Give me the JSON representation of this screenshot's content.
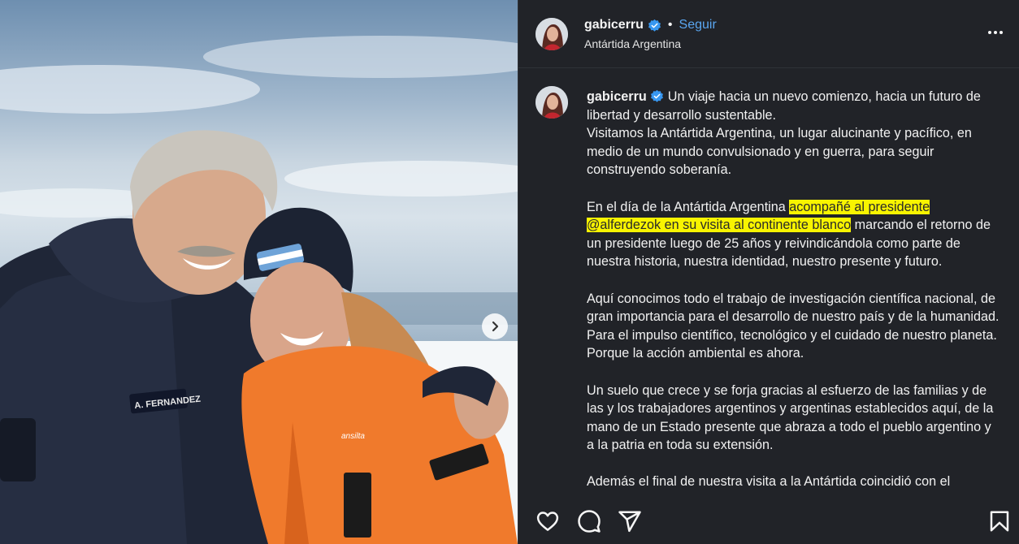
{
  "post": {
    "username": "gabicerru",
    "follow_label": "Seguir",
    "separator": "•",
    "location": "Antártida Argentina"
  },
  "photo": {
    "jacket_badge": "A. FERNANDEZ",
    "jacket_brand": "ansilta"
  },
  "caption": {
    "username": "gabicerru",
    "p1": "Un viaje hacia un nuevo comienzo, hacia un futuro de libertad y desarrollo sustentable.",
    "p1b": "Visitamos la Antártida Argentina, un lugar alucinante y pacífico, en medio de un mundo convulsionado y en guerra, para seguir construyendo soberanía.",
    "p2_before": "En el día de la Antártida Argentina ",
    "p2_highlight": "acompañé al presidente @alferdezok en su visita al continente blanco",
    "p2_after": " marcando el retorno de un presidente luego de 25 años y reivindicándola como parte de nuestra historia, nuestra identidad, nuestro presente y futuro.",
    "p3": "Aquí conocimos todo el trabajo de investigación científica nacional, de gran importancia para el desarrollo de nuestro país y de la humanidad. Para el impulso científico, tecnológico y el cuidado de nuestro planeta. Porque la acción ambiental es ahora.",
    "p4": "Un suelo que crece y se forja gracias al esfuerzo de las familias y de las y los trabajadores argentinos y argentinas establecidos aquí, de la mano de un Estado presente que abraza a todo el pueblo argentino y a la patria en toda su extensión.",
    "p5": "Además el final de nuestra visita a la Antártida coincidió con el"
  },
  "colors": {
    "panel_bg": "#212328",
    "follow": "#5aa6f0",
    "highlight": "#f8f400",
    "verified": "#3897f0"
  },
  "icons": [
    "verified-badge-icon",
    "more-options-icon",
    "chevron-right-icon",
    "heart-icon",
    "comment-icon",
    "share-icon",
    "bookmark-icon"
  ]
}
